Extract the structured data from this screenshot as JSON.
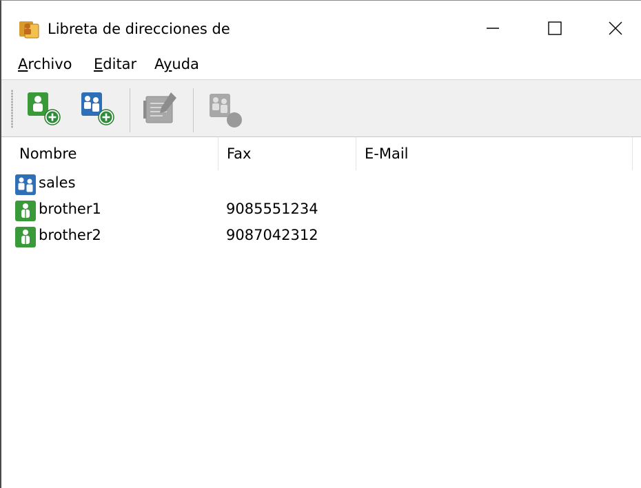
{
  "window": {
    "title": "Libreta de direcciones de",
    "controls": {
      "minimize": "minimize-icon",
      "maximize": "maximize-icon",
      "close": "close-icon"
    }
  },
  "menu": {
    "items": [
      {
        "accel": "A",
        "rest": "rchivo"
      },
      {
        "accel": "E",
        "rest": "ditar"
      },
      {
        "before": "A",
        "accel": "y",
        "rest": "uda"
      }
    ]
  },
  "toolbar": {
    "buttons": [
      {
        "icon": "add-contact-icon",
        "enabled": true
      },
      {
        "icon": "add-group-icon",
        "enabled": true
      },
      {
        "icon": "edit-icon",
        "enabled": false
      },
      {
        "icon": "delete-icon",
        "enabled": false
      }
    ]
  },
  "list": {
    "columns": {
      "name": "Nombre",
      "fax": "Fax",
      "email": "E-Mail"
    },
    "rows": [
      {
        "type": "group",
        "icon": "group-icon",
        "name": "sales",
        "fax": "",
        "email": ""
      },
      {
        "type": "contact",
        "icon": "contact-icon",
        "name": "brother1",
        "fax": "9085551234",
        "email": ""
      },
      {
        "type": "contact",
        "icon": "contact-icon",
        "name": "brother2",
        "fax": "9087042312",
        "email": ""
      }
    ]
  },
  "colors": {
    "contact_green": "#3a9a3a",
    "group_blue": "#2f6fb5",
    "toolbar_bg": "#f0f0f0",
    "disabled_gray": "#9a9a9a"
  }
}
